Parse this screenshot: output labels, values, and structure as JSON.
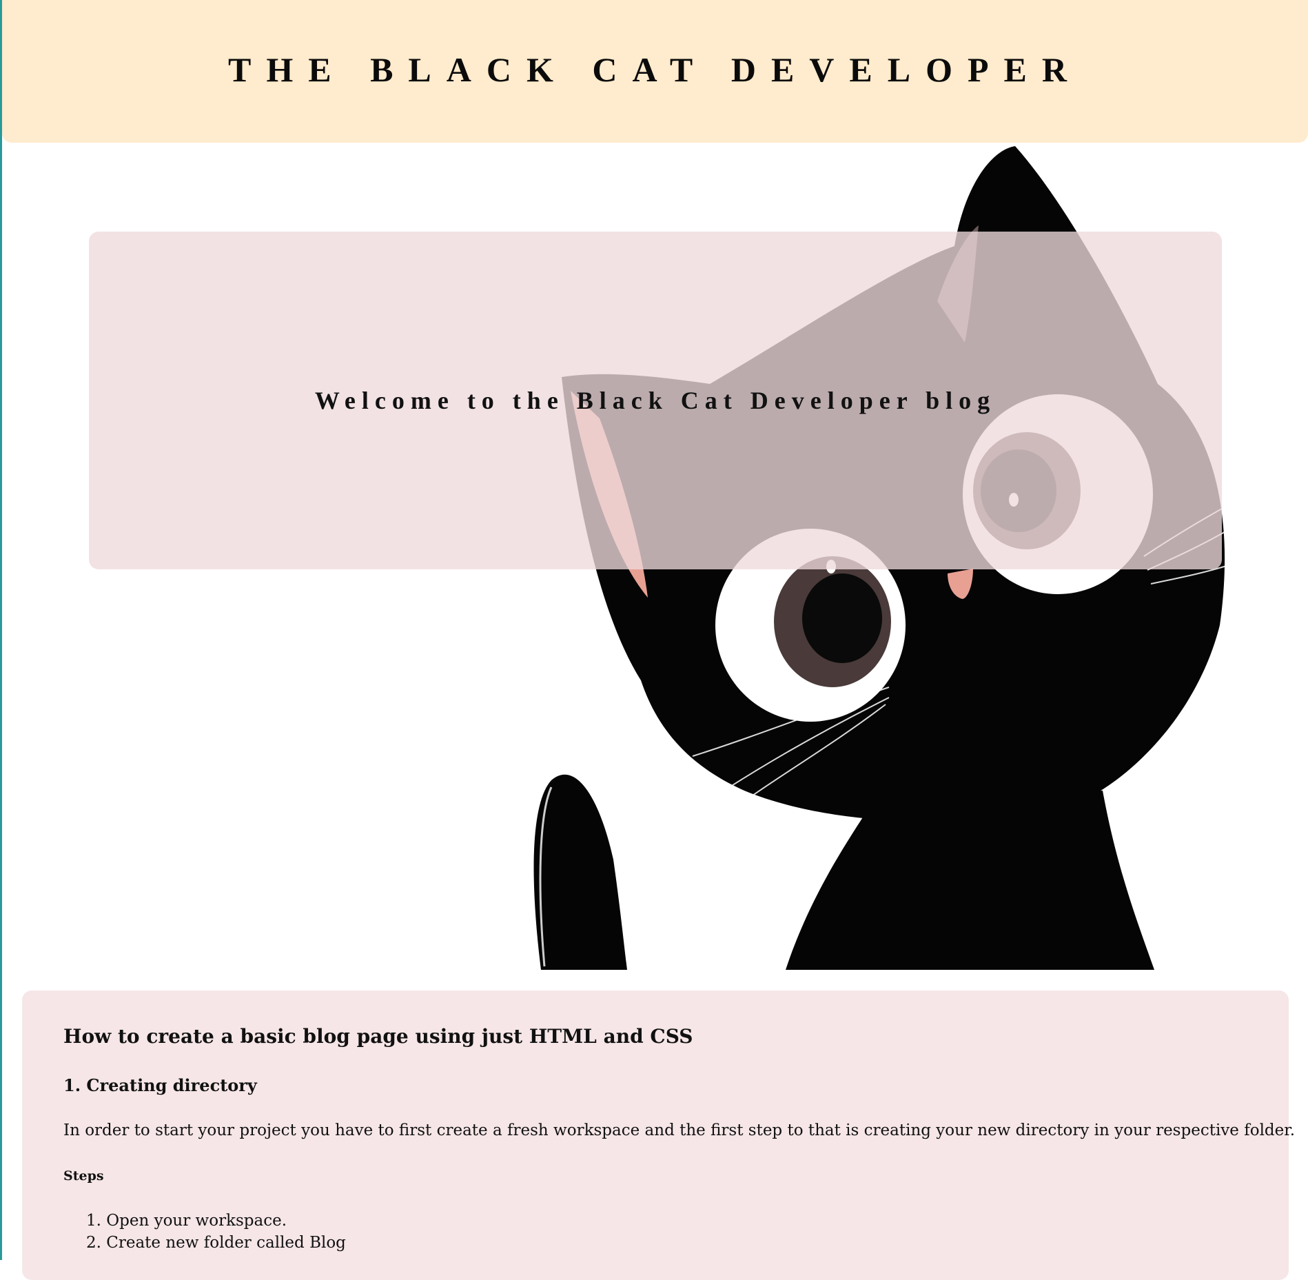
{
  "header": {
    "title": "THE BLACK CAT DEVELOPER"
  },
  "hero": {
    "welcome": "Welcome to the Black Cat Developer blog",
    "image_icon": "black-cat-illustration"
  },
  "article": {
    "title": "How to create a basic blog page using just HTML and CSS",
    "section_title": "1. Creating directory",
    "paragraph": "In order to start your project you have to first create a fresh workspace and the first step to that is creating your new directory in your respective folder.",
    "steps_label": "Steps",
    "steps": [
      "1. Open your workspace.",
      "2. Create new folder called Blog"
    ]
  },
  "colors": {
    "header_bg": "#ffebcd",
    "panel_bg": "#eedadd",
    "article_bg": "#f6e6e7",
    "cat": "#050505",
    "cat_ear_inner": "#e8a093",
    "nose": "#e8a093"
  }
}
